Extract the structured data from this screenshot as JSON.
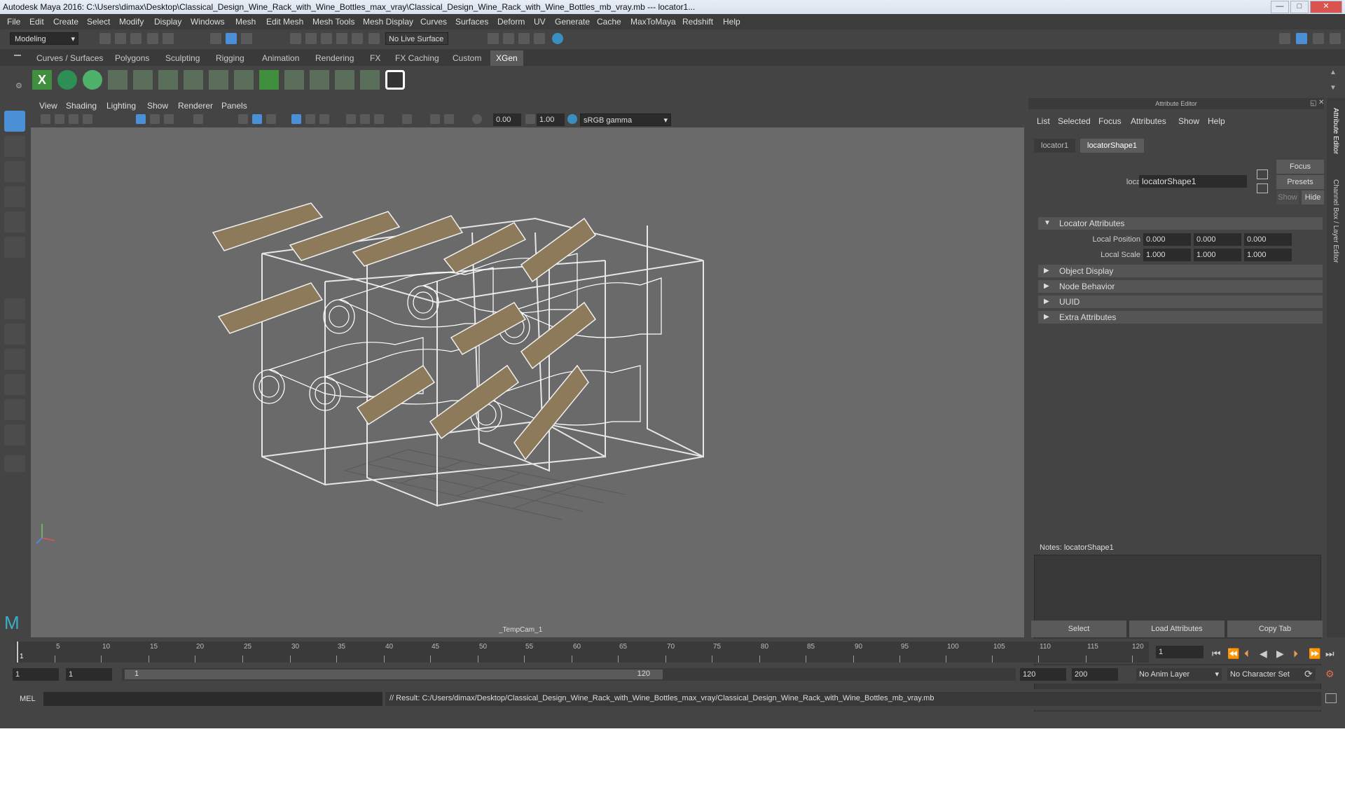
{
  "window": {
    "title": "Autodesk Maya 2016: C:\\Users\\dimax\\Desktop\\Classical_Design_Wine_Rack_with_Wine_Bottles_max_vray\\Classical_Design_Wine_Rack_with_Wine_Bottles_mb_vray.mb   ---   locator1...",
    "minimize": "—",
    "maximize": "□",
    "close": "✕"
  },
  "menubar": [
    "File",
    "Edit",
    "Create",
    "Select",
    "Modify",
    "Display",
    "Windows",
    "Mesh",
    "Edit Mesh",
    "Mesh Tools",
    "Mesh Display",
    "Curves",
    "Surfaces",
    "Deform",
    "UV",
    "Generate",
    "Cache",
    "MaxToMaya",
    "Redshift",
    "Help"
  ],
  "statusline": {
    "mode": "Modeling",
    "live_surface": "No Live Surface"
  },
  "shelf_tabs": [
    "Curves / Surfaces",
    "Polygons",
    "Sculpting",
    "Rigging",
    "Animation",
    "Rendering",
    "FX",
    "FX Caching",
    "Custom",
    "XGen"
  ],
  "shelf_active": "XGen",
  "viewport": {
    "menu": [
      "View",
      "Shading",
      "Lighting",
      "Show",
      "Renderer",
      "Panels"
    ],
    "exposure": "0.00",
    "gamma": "1.00",
    "color_space": "sRGB gamma",
    "camera": "_TempCam_1"
  },
  "attribute_editor": {
    "header": "Attribute Editor",
    "menu": [
      "List",
      "Selected",
      "Focus",
      "Attributes",
      "Show",
      "Help"
    ],
    "tabs": [
      "locator1",
      "locatorShape1"
    ],
    "active_tab": "locatorShape1",
    "node_label": "locator:",
    "node_value": "locatorShape1",
    "focus": "Focus",
    "presets": "Presets",
    "show": "Show",
    "hide": "Hide",
    "sections": [
      {
        "label": "Locator Attributes",
        "open": true
      },
      {
        "label": "Object Display",
        "open": false
      },
      {
        "label": "Node Behavior",
        "open": false
      },
      {
        "label": "UUID",
        "open": false
      },
      {
        "label": "Extra Attributes",
        "open": false
      }
    ],
    "local_position": {
      "label": "Local Position",
      "values": [
        "0.000",
        "0.000",
        "0.000"
      ]
    },
    "local_scale": {
      "label": "Local Scale",
      "values": [
        "1.000",
        "1.000",
        "1.000"
      ]
    },
    "notes_label": "Notes:  locatorShape1",
    "buttons": [
      "Select",
      "Load Attributes",
      "Copy Tab"
    ]
  },
  "side_tabs": [
    "Attribute Editor",
    "Channel Box / Layer Editor"
  ],
  "timeline": {
    "ticks": [
      "5",
      "10",
      "15",
      "20",
      "25",
      "30",
      "35",
      "40",
      "45",
      "50",
      "55",
      "60",
      "65",
      "70",
      "75",
      "80",
      "85",
      "90",
      "95",
      "100",
      "105",
      "110",
      "115",
      "120"
    ],
    "start_marker": "1",
    "current_frame": "1"
  },
  "range": {
    "start": "1",
    "playback_start": "1",
    "slider_start": "1",
    "slider_end": "120",
    "playback_end": "120",
    "end": "200",
    "anim_layer": "No Anim Layer",
    "character_set": "No Character Set"
  },
  "command": {
    "lang": "MEL",
    "result": "// Result: C:/Users/dimax/Desktop/Classical_Design_Wine_Rack_with_Wine_Bottles_max_vray/Classical_Design_Wine_Rack_with_Wine_Bottles_mb_vray.mb"
  },
  "colors": {
    "accent": "#4b8fd6",
    "wood": "#8c7a5a",
    "wire": "#ffffff"
  }
}
